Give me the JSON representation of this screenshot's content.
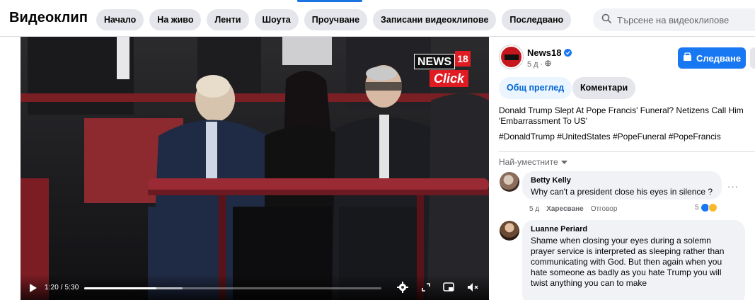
{
  "header": {
    "title": "Видеоклип",
    "tabs": [
      {
        "label": "Начало"
      },
      {
        "label": "На живо"
      },
      {
        "label": "Ленти"
      },
      {
        "label": "Шоута"
      },
      {
        "label": "Проучване"
      },
      {
        "label": "Записани видеоклипове"
      },
      {
        "label": "Последвано"
      }
    ],
    "search_placeholder": "Търсене на видеоклипове"
  },
  "video": {
    "logo_top": "NEWS",
    "logo_num": "18",
    "logo_bottom": "Click",
    "time": "1:20 / 5:30",
    "progress_fraction": 0.242,
    "buffer_fraction": 0.33
  },
  "post": {
    "page_name": "News18",
    "meta": "5 д · ",
    "follow_label": "Следване",
    "tab_overview": "Общ преглед",
    "tab_comments": "Коментари",
    "text": "Donald Trump Slept At Pope Francis' Funeral? Netizens Call Him 'Embarrassment To US'",
    "hashtags": "#DonaldTrump #UnitedStates #PopeFuneral #PopeFrancis",
    "sort_label": "Най-уместните"
  },
  "comments": [
    {
      "author": "Betty Kelly",
      "text": "Why can't a president close his eyes in silence ?",
      "time": "5 д",
      "like": "Харесване",
      "reply": "Отговор",
      "reactions": "5"
    },
    {
      "author": "Luanne Periard",
      "text": "Shame when closing your eyes during a solemn prayer service is interpreted as sleeping rather than communicating with God. But then again when you hate someone as badly as you hate Trump you will twist anything you can to make"
    }
  ],
  "colors": {
    "accent": "#1877f2",
    "brand_red": "#e01b22"
  }
}
